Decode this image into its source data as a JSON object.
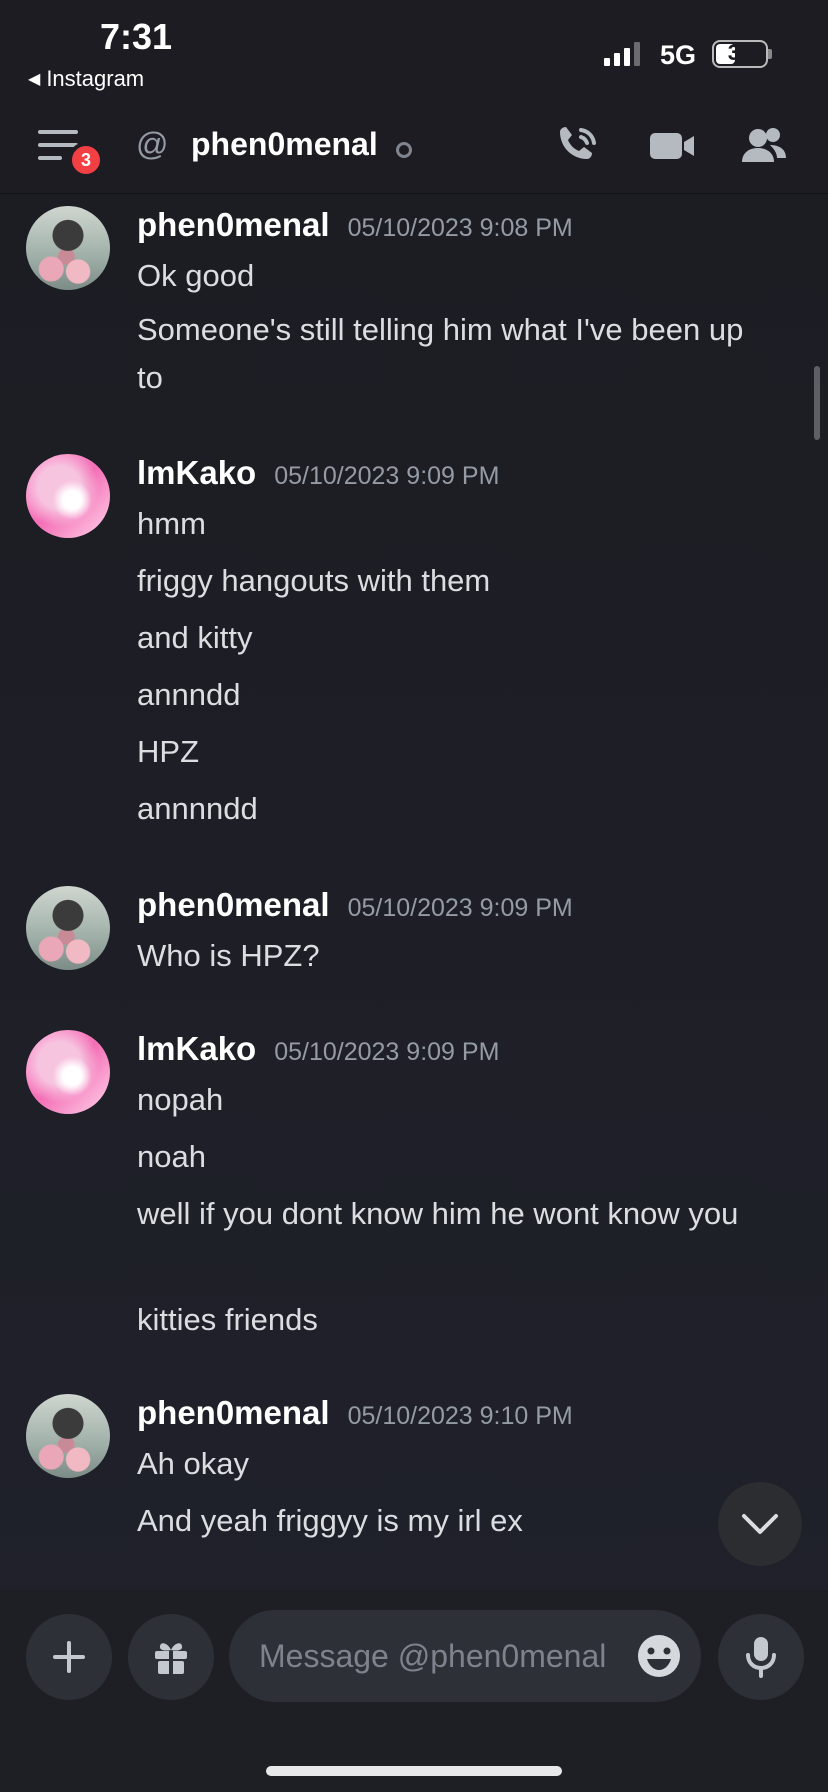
{
  "status_bar": {
    "time": "7:31",
    "back_app": "Instagram",
    "network": "5G",
    "battery": "37"
  },
  "header": {
    "unread_count": "3",
    "at_symbol": "@",
    "title": "phen0menal"
  },
  "messages": [
    {
      "author": "phen0menal",
      "timestamp": "05/10/2023 9:08 PM",
      "lines": [
        "Ok good",
        "Someone's still telling him what I've been up to"
      ]
    },
    {
      "author": "lmKako",
      "timestamp": "05/10/2023 9:09 PM",
      "lines": [
        "hmm",
        "friggy hangouts with them",
        "and kitty",
        "annndd",
        "HPZ",
        "annnndd"
      ]
    },
    {
      "author": "phen0menal",
      "timestamp": "05/10/2023 9:09 PM",
      "lines": [
        "Who is HPZ?"
      ]
    },
    {
      "author": "lmKako",
      "timestamp": "05/10/2023 9:09 PM",
      "lines": [
        "nopah",
        "noah",
        "well if you dont know him he wont know you",
        "kitties friends"
      ]
    },
    {
      "author": "phen0menal",
      "timestamp": "05/10/2023 9:10 PM",
      "lines": [
        "Ah okay",
        "And yeah friggyy is my irl ex"
      ]
    }
  ],
  "composer": {
    "placeholder": "Message @phen0menal"
  },
  "icons": {
    "menu": "menu-icon",
    "call": "phone-call-icon",
    "video": "video-camera-icon",
    "members": "members-icon",
    "add": "plus-icon",
    "gift": "gift-icon",
    "emoji": "emoji-icon",
    "mic": "microphone-icon",
    "jump": "chevron-down-icon"
  },
  "colors": {
    "background": "#1c1c22",
    "badge": "#f23f43",
    "muted_text": "#949ba4",
    "message_text": "#dbdee1"
  }
}
